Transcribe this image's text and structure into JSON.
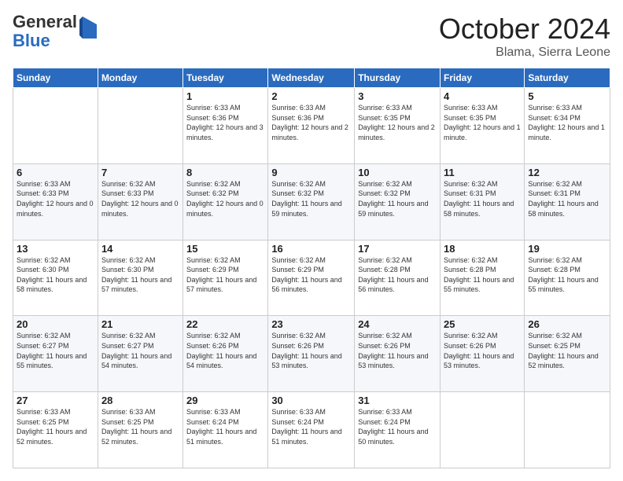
{
  "header": {
    "logo_general": "General",
    "logo_blue": "Blue",
    "month": "October 2024",
    "location": "Blama, Sierra Leone"
  },
  "days_of_week": [
    "Sunday",
    "Monday",
    "Tuesday",
    "Wednesday",
    "Thursday",
    "Friday",
    "Saturday"
  ],
  "weeks": [
    [
      {
        "day": "",
        "sunrise": "",
        "sunset": "",
        "daylight": ""
      },
      {
        "day": "",
        "sunrise": "",
        "sunset": "",
        "daylight": ""
      },
      {
        "day": "1",
        "sunrise": "Sunrise: 6:33 AM",
        "sunset": "Sunset: 6:36 PM",
        "daylight": "Daylight: 12 hours and 3 minutes."
      },
      {
        "day": "2",
        "sunrise": "Sunrise: 6:33 AM",
        "sunset": "Sunset: 6:36 PM",
        "daylight": "Daylight: 12 hours and 2 minutes."
      },
      {
        "day": "3",
        "sunrise": "Sunrise: 6:33 AM",
        "sunset": "Sunset: 6:35 PM",
        "daylight": "Daylight: 12 hours and 2 minutes."
      },
      {
        "day": "4",
        "sunrise": "Sunrise: 6:33 AM",
        "sunset": "Sunset: 6:35 PM",
        "daylight": "Daylight: 12 hours and 1 minute."
      },
      {
        "day": "5",
        "sunrise": "Sunrise: 6:33 AM",
        "sunset": "Sunset: 6:34 PM",
        "daylight": "Daylight: 12 hours and 1 minute."
      }
    ],
    [
      {
        "day": "6",
        "sunrise": "Sunrise: 6:33 AM",
        "sunset": "Sunset: 6:33 PM",
        "daylight": "Daylight: 12 hours and 0 minutes."
      },
      {
        "day": "7",
        "sunrise": "Sunrise: 6:32 AM",
        "sunset": "Sunset: 6:33 PM",
        "daylight": "Daylight: 12 hours and 0 minutes."
      },
      {
        "day": "8",
        "sunrise": "Sunrise: 6:32 AM",
        "sunset": "Sunset: 6:32 PM",
        "daylight": "Daylight: 12 hours and 0 minutes."
      },
      {
        "day": "9",
        "sunrise": "Sunrise: 6:32 AM",
        "sunset": "Sunset: 6:32 PM",
        "daylight": "Daylight: 11 hours and 59 minutes."
      },
      {
        "day": "10",
        "sunrise": "Sunrise: 6:32 AM",
        "sunset": "Sunset: 6:32 PM",
        "daylight": "Daylight: 11 hours and 59 minutes."
      },
      {
        "day": "11",
        "sunrise": "Sunrise: 6:32 AM",
        "sunset": "Sunset: 6:31 PM",
        "daylight": "Daylight: 11 hours and 58 minutes."
      },
      {
        "day": "12",
        "sunrise": "Sunrise: 6:32 AM",
        "sunset": "Sunset: 6:31 PM",
        "daylight": "Daylight: 11 hours and 58 minutes."
      }
    ],
    [
      {
        "day": "13",
        "sunrise": "Sunrise: 6:32 AM",
        "sunset": "Sunset: 6:30 PM",
        "daylight": "Daylight: 11 hours and 58 minutes."
      },
      {
        "day": "14",
        "sunrise": "Sunrise: 6:32 AM",
        "sunset": "Sunset: 6:30 PM",
        "daylight": "Daylight: 11 hours and 57 minutes."
      },
      {
        "day": "15",
        "sunrise": "Sunrise: 6:32 AM",
        "sunset": "Sunset: 6:29 PM",
        "daylight": "Daylight: 11 hours and 57 minutes."
      },
      {
        "day": "16",
        "sunrise": "Sunrise: 6:32 AM",
        "sunset": "Sunset: 6:29 PM",
        "daylight": "Daylight: 11 hours and 56 minutes."
      },
      {
        "day": "17",
        "sunrise": "Sunrise: 6:32 AM",
        "sunset": "Sunset: 6:28 PM",
        "daylight": "Daylight: 11 hours and 56 minutes."
      },
      {
        "day": "18",
        "sunrise": "Sunrise: 6:32 AM",
        "sunset": "Sunset: 6:28 PM",
        "daylight": "Daylight: 11 hours and 55 minutes."
      },
      {
        "day": "19",
        "sunrise": "Sunrise: 6:32 AM",
        "sunset": "Sunset: 6:28 PM",
        "daylight": "Daylight: 11 hours and 55 minutes."
      }
    ],
    [
      {
        "day": "20",
        "sunrise": "Sunrise: 6:32 AM",
        "sunset": "Sunset: 6:27 PM",
        "daylight": "Daylight: 11 hours and 55 minutes."
      },
      {
        "day": "21",
        "sunrise": "Sunrise: 6:32 AM",
        "sunset": "Sunset: 6:27 PM",
        "daylight": "Daylight: 11 hours and 54 minutes."
      },
      {
        "day": "22",
        "sunrise": "Sunrise: 6:32 AM",
        "sunset": "Sunset: 6:26 PM",
        "daylight": "Daylight: 11 hours and 54 minutes."
      },
      {
        "day": "23",
        "sunrise": "Sunrise: 6:32 AM",
        "sunset": "Sunset: 6:26 PM",
        "daylight": "Daylight: 11 hours and 53 minutes."
      },
      {
        "day": "24",
        "sunrise": "Sunrise: 6:32 AM",
        "sunset": "Sunset: 6:26 PM",
        "daylight": "Daylight: 11 hours and 53 minutes."
      },
      {
        "day": "25",
        "sunrise": "Sunrise: 6:32 AM",
        "sunset": "Sunset: 6:26 PM",
        "daylight": "Daylight: 11 hours and 53 minutes."
      },
      {
        "day": "26",
        "sunrise": "Sunrise: 6:32 AM",
        "sunset": "Sunset: 6:25 PM",
        "daylight": "Daylight: 11 hours and 52 minutes."
      }
    ],
    [
      {
        "day": "27",
        "sunrise": "Sunrise: 6:33 AM",
        "sunset": "Sunset: 6:25 PM",
        "daylight": "Daylight: 11 hours and 52 minutes."
      },
      {
        "day": "28",
        "sunrise": "Sunrise: 6:33 AM",
        "sunset": "Sunset: 6:25 PM",
        "daylight": "Daylight: 11 hours and 52 minutes."
      },
      {
        "day": "29",
        "sunrise": "Sunrise: 6:33 AM",
        "sunset": "Sunset: 6:24 PM",
        "daylight": "Daylight: 11 hours and 51 minutes."
      },
      {
        "day": "30",
        "sunrise": "Sunrise: 6:33 AM",
        "sunset": "Sunset: 6:24 PM",
        "daylight": "Daylight: 11 hours and 51 minutes."
      },
      {
        "day": "31",
        "sunrise": "Sunrise: 6:33 AM",
        "sunset": "Sunset: 6:24 PM",
        "daylight": "Daylight: 11 hours and 50 minutes."
      },
      {
        "day": "",
        "sunrise": "",
        "sunset": "",
        "daylight": ""
      },
      {
        "day": "",
        "sunrise": "",
        "sunset": "",
        "daylight": ""
      }
    ]
  ]
}
